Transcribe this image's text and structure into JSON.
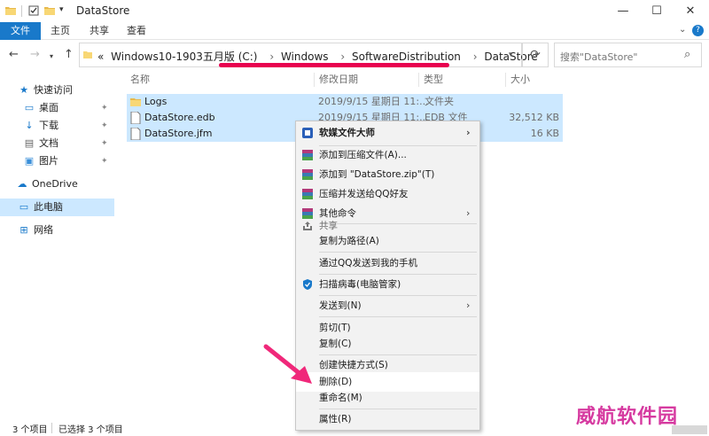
{
  "window": {
    "title": "DataStore",
    "buttons": {
      "minimize": "—",
      "maximize": "☐",
      "close": "✕"
    }
  },
  "ribbon": {
    "tabs": [
      "文件",
      "主页",
      "共享",
      "查看"
    ],
    "help": "?"
  },
  "address": {
    "prefix": "«",
    "segments": [
      "Windows10-1903五月版 (C:)",
      "Windows",
      "SoftwareDistribution",
      "DataStore"
    ],
    "chevron": "›"
  },
  "search": {
    "placeholder": "搜索\"DataStore\""
  },
  "nav_pane": {
    "quick_access": "快速访问",
    "items": [
      {
        "label": "桌面",
        "icon": "desktop-icon"
      },
      {
        "label": "下载",
        "icon": "download-icon"
      },
      {
        "label": "文档",
        "icon": "document-icon"
      },
      {
        "label": "图片",
        "icon": "picture-icon"
      }
    ],
    "onedrive": "OneDrive",
    "this_pc": "此电脑",
    "network": "网络"
  },
  "columns": {
    "name": "名称",
    "date": "修改日期",
    "type": "类型",
    "size": "大小"
  },
  "files": [
    {
      "name": "Logs",
      "date": "2019/9/15 星期日 11:...",
      "type": "文件夹",
      "size": "",
      "icon": "folder-icon"
    },
    {
      "name": "DataStore.edb",
      "date": "2019/9/15 星期日 11:...",
      "type": "EDB 文件",
      "size": "32,512 KB",
      "icon": "file-icon"
    },
    {
      "name": "DataStore.jfm",
      "date": "",
      "type": "",
      "size": "16 KB",
      "icon": "file-icon"
    }
  ],
  "context_menu": {
    "items": [
      {
        "label": "软媒文件大师",
        "submenu": true,
        "bold": true
      },
      {
        "label": "添加到压缩文件(A)..."
      },
      {
        "label": "添加到 \"DataStore.zip\"(T)"
      },
      {
        "label": "压缩并发送给QQ好友"
      },
      {
        "label": "其他命令",
        "submenu": true
      },
      {
        "label": "共享",
        "disabled": true
      },
      {
        "label": "复制为路径(A)"
      },
      {
        "label": "通过QQ发送到我的手机"
      },
      {
        "label": "扫描病毒(电脑管家)"
      },
      {
        "label": "发送到(N)",
        "submenu": true
      },
      {
        "label": "剪切(T)"
      },
      {
        "label": "复制(C)"
      },
      {
        "label": "创建快捷方式(S)"
      },
      {
        "label": "删除(D)",
        "highlighted": true
      },
      {
        "label": "重命名(M)"
      },
      {
        "label": "属性(R)"
      }
    ],
    "arrow": "›"
  },
  "status": {
    "count": "3 个项目",
    "selected": "已选择 3 个项目"
  },
  "watermark": "威航软件园",
  "colors": {
    "accent": "#1979ca",
    "selection": "#cce8ff",
    "annotation": "#e8004f"
  }
}
